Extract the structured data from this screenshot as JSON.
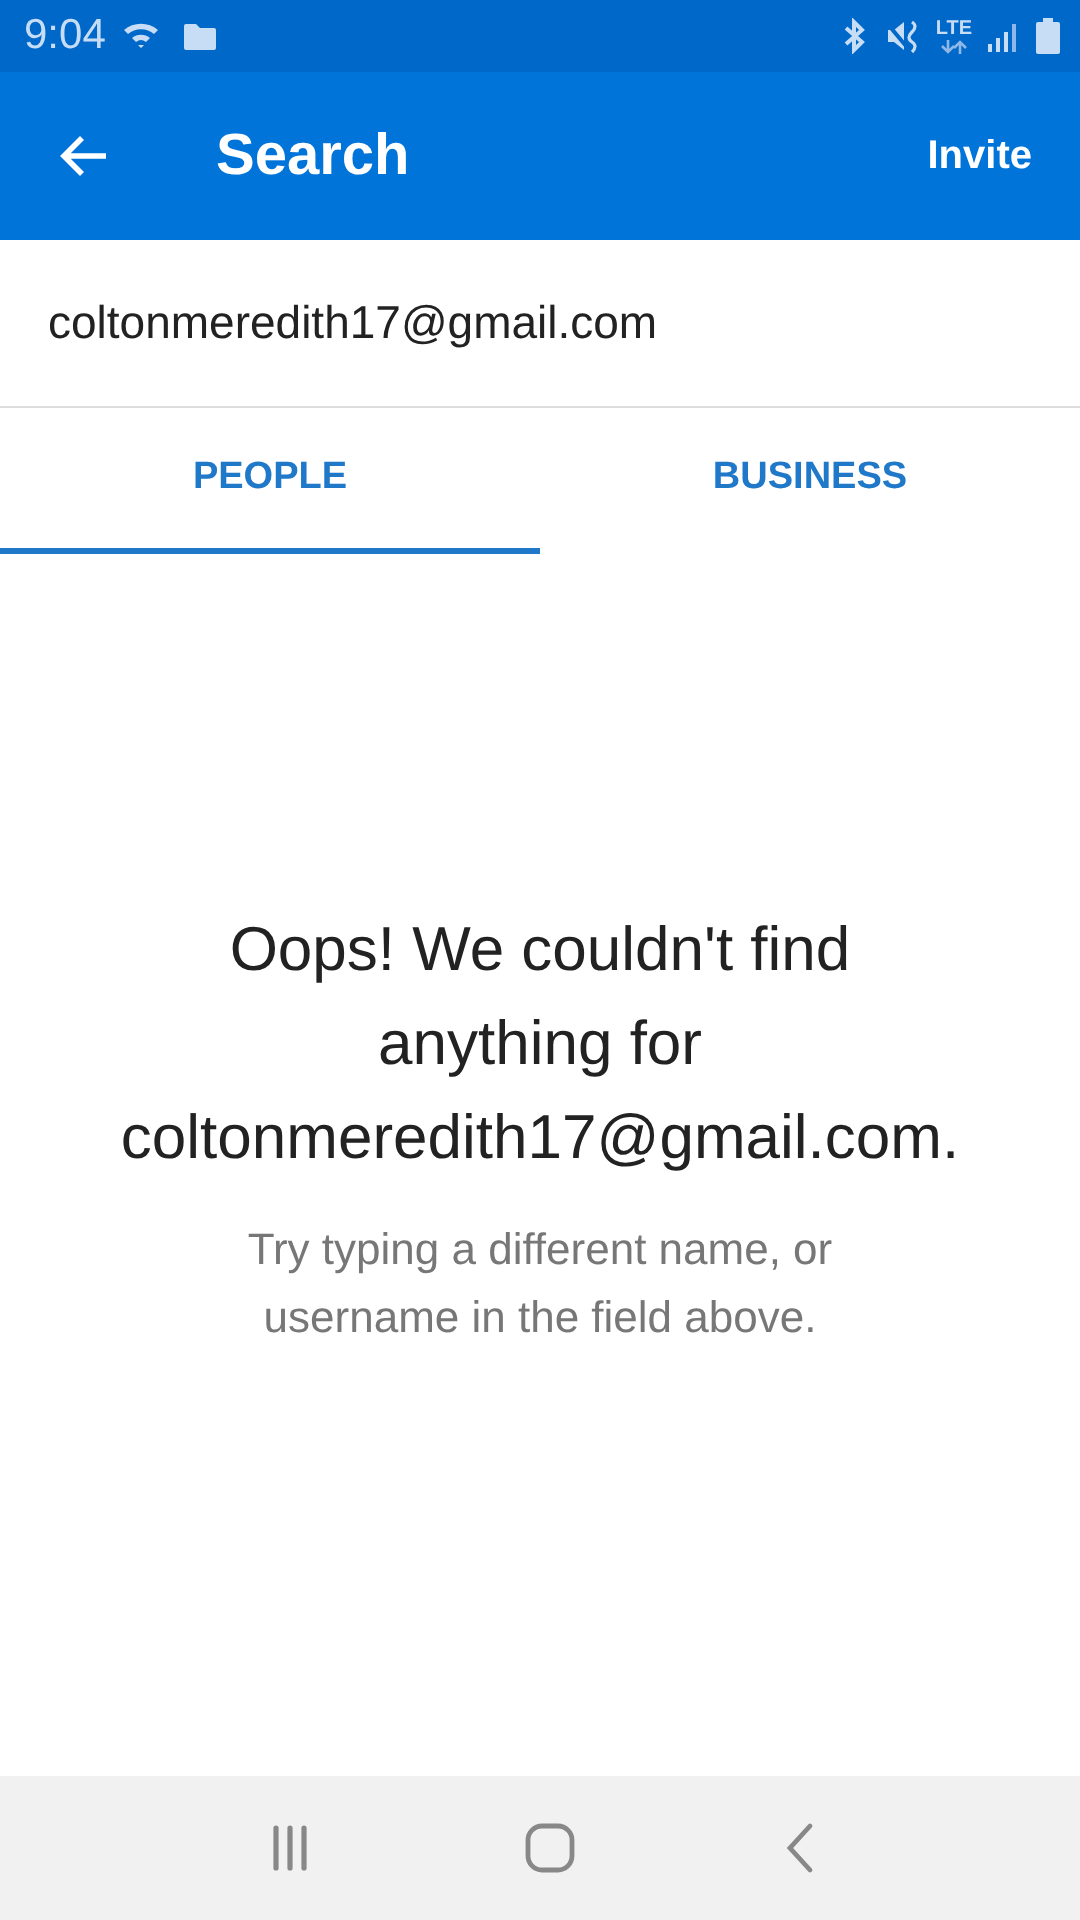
{
  "status_bar": {
    "time": "9:04",
    "network": "LTE"
  },
  "app_bar": {
    "title": "Search",
    "action": "Invite"
  },
  "search": {
    "value": "coltonmeredith17@gmail.com"
  },
  "tabs": [
    {
      "label": "PEOPLE",
      "selected": true
    },
    {
      "label": "BUSINESS",
      "selected": false
    }
  ],
  "empty_state": {
    "heading": "Oops! We couldn't find anything for coltonmeredith17@gmail.com.",
    "hint": "Try typing a different name, or username in the field above."
  }
}
